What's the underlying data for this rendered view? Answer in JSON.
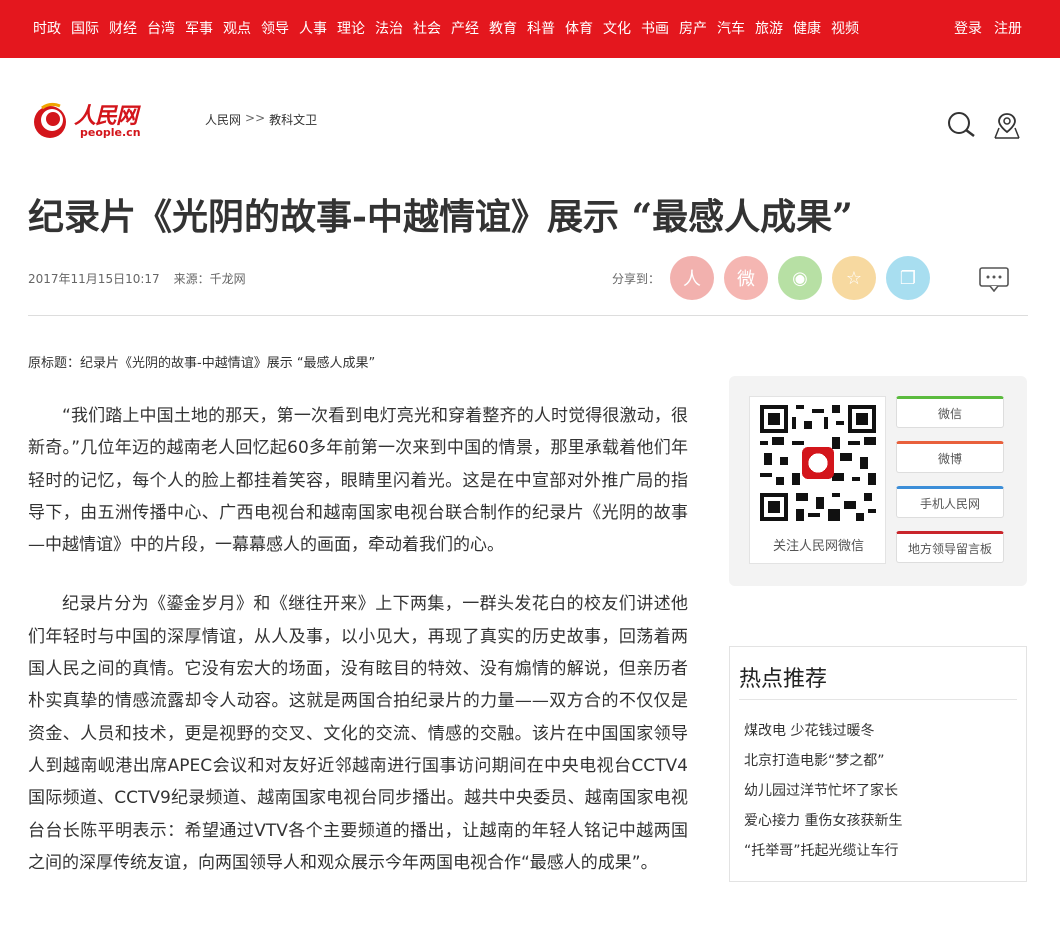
{
  "nav": {
    "items": [
      "时政",
      "国际",
      "财经",
      "台湾",
      "军事",
      "观点",
      "领导",
      "人事",
      "理论",
      "法治",
      "社会",
      "产经",
      "教育",
      "科普",
      "体育",
      "文化",
      "书画",
      "房产",
      "汽车",
      "旅游",
      "健康",
      "视频"
    ],
    "login": "登录",
    "register": "注册"
  },
  "logo": {
    "cn": "人民网",
    "en": "people.cn"
  },
  "breadcrumb": {
    "home": "人民网",
    "sep": ">>",
    "section": "教科文卫"
  },
  "article": {
    "title": "纪录片《光阴的故事-中越情谊》展示 “最感人成果”",
    "date": "2017年11月15日10:17",
    "source": "来源：千龙网",
    "share_label": "分享到：",
    "original_title": "原标题：纪录片《光阴的故事-中越情谊》展示 “最感人成果”",
    "paragraphs": [
      "“我们踏上中国土地的那天，第一次看到电灯亮光和穿着整齐的人时觉得很激动，很新奇。”几位年迈的越南老人回忆起60多年前第一次来到中国的情景，那里承载着他们年轻时的记忆，每个人的脸上都挂着笑容，眼睛里闪着光。这是在中宣部对外推广局的指导下，由五洲传播中心、广西电视台和越南国家电视台联合制作的纪录片《光阴的故事—中越情谊》中的片段，一幕幕感人的画面，牵动着我们的心。",
      "纪录片分为《鎏金岁月》和《继往开来》上下两集，一群头发花白的校友们讲述他们年轻时与中国的深厚情谊，从人及事，以小见大，再现了真实的历史故事，回荡着两国人民之间的真情。它没有宏大的场面，没有眩目的特效、没有煽情的解说，但亲历者朴实真挚的情感流露却令人动容。这就是两国合拍纪录片的力量——双方合的不仅仅是资金、人员和技术，更是视野的交叉、文化的交流、情感的交融。该片在中国国家领导人到越南岘港出席APEC会议和对友好近邻越南进行国事访问期间在中央电视台CCTV4国际频道、CCTV9纪录频道、越南国家电视台同步播出。越共中央委员、越南国家电视台台长陈平明表示：希望通过VTV各个主要频道的播出，让越南的年轻人铭记中越两国之间的深厚传统友谊，向两国领导人和观众展示今年两国电视合作“最感人的成果”。"
    ]
  },
  "share_icons": [
    {
      "name": "people-share-icon",
      "glyph": "人",
      "color": "#f2b1ae"
    },
    {
      "name": "weibo-share-icon",
      "glyph": "微",
      "color": "#f5b6b2"
    },
    {
      "name": "wechat-share-icon",
      "glyph": "◉",
      "color": "#b7e0a4"
    },
    {
      "name": "favorite-share-icon",
      "glyph": "☆",
      "color": "#f7d9a0"
    },
    {
      "name": "copy-share-icon",
      "glyph": "❐",
      "color": "#a8def0"
    }
  ],
  "sidebar": {
    "qr_caption": "关注人民网微信",
    "buttons": [
      {
        "label": "微信",
        "color": "#5bbb3e"
      },
      {
        "label": "微博",
        "color": "#e8603c"
      },
      {
        "label": "手机人民网",
        "color": "#3c8ed8"
      },
      {
        "label": "地方领导留言板",
        "color": "#c9252b"
      }
    ],
    "hot_title": "热点推荐",
    "hot_items": [
      "煤改电 少花钱过暖冬",
      "北京打造电影“梦之都”",
      "幼儿园过洋节忙坏了家长",
      "爱心接力 重伤女孩获新生",
      "“托举哥”托起光缆让车行"
    ]
  }
}
